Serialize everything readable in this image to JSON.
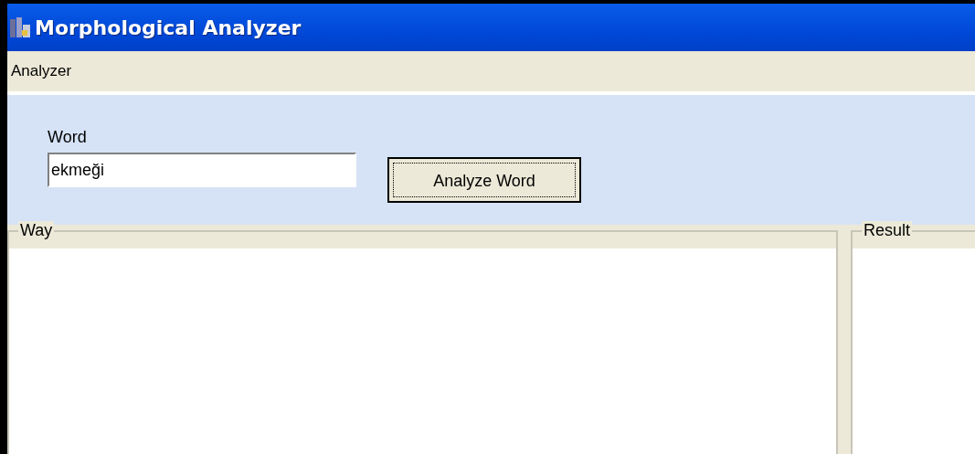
{
  "window": {
    "title": "Morphological Analyzer"
  },
  "menu": [
    "Analyzer"
  ],
  "form": {
    "label": "Word",
    "value": "ekmeği",
    "button": "Analyze Word"
  },
  "groups": [
    {
      "title": "Way"
    },
    {
      "title": "Result"
    }
  ]
}
